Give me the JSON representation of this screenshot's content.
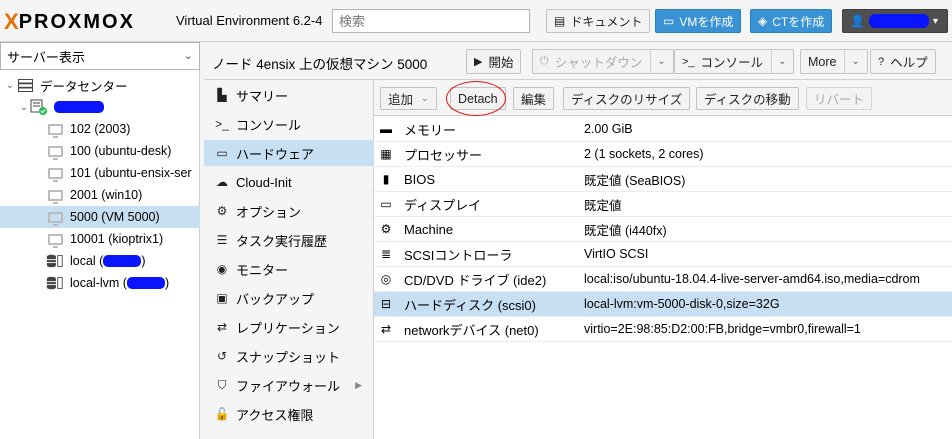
{
  "topbar": {
    "logo_mark": "X",
    "logo_word": "PROXMOX",
    "product": "Virtual Environment 6.2-4",
    "search_placeholder": "検索",
    "docs_label": "ドキュメント",
    "create_vm_label": "VMを作成",
    "create_ct_label": "CTを作成"
  },
  "tree": {
    "view_selector": "サーバー表示",
    "nodes": [
      {
        "label": "データセンター",
        "icon": "datacenter-icon"
      },
      {
        "label": "",
        "icon": "node-server-icon"
      },
      {
        "label": "102 (2003)",
        "icon": "vm-icon"
      },
      {
        "label": "100 (ubuntu-desk)",
        "icon": "vm-icon"
      },
      {
        "label": "101 (ubuntu-ensix-ser",
        "icon": "vm-icon"
      },
      {
        "label": "2001 (win10)",
        "icon": "vm-icon"
      },
      {
        "label": "5000 (VM 5000)",
        "icon": "vm-icon",
        "selected": true
      },
      {
        "label": "10001 (kioptrix1)",
        "icon": "vm-icon"
      },
      {
        "label": "local (",
        "suffix": ")",
        "icon": "storage-icon"
      },
      {
        "label": "local-lvm (",
        "suffix": ")",
        "icon": "storage-icon"
      }
    ]
  },
  "header": {
    "title": "ノード 4ensix 上の仮想マシン 5000",
    "start": "開始",
    "shutdown": "シャットダウン",
    "console": "コンソール",
    "more": "More",
    "help": "ヘルプ"
  },
  "subnav": {
    "items": [
      {
        "label": "サマリー",
        "icon": "summary-icon"
      },
      {
        "label": "コンソール",
        "icon": "terminal-icon"
      },
      {
        "label": "ハードウェア",
        "icon": "hardware-icon",
        "selected": true
      },
      {
        "label": "Cloud-Init",
        "icon": "cloud-icon"
      },
      {
        "label": "オプション",
        "icon": "gear-icon"
      },
      {
        "label": "タスク実行履歴",
        "icon": "list-icon"
      },
      {
        "label": "モニター",
        "icon": "eye-icon"
      },
      {
        "label": "バックアップ",
        "icon": "floppy-icon"
      },
      {
        "label": "レプリケーション",
        "icon": "retweet-icon"
      },
      {
        "label": "スナップショット",
        "icon": "history-icon"
      },
      {
        "label": "ファイアウォール",
        "icon": "shield-icon"
      },
      {
        "label": "アクセス権限",
        "icon": "unlock-icon"
      }
    ]
  },
  "toolbar": {
    "add": "追加",
    "detach": "Detach",
    "edit": "編集",
    "resize": "ディスクのリサイズ",
    "move": "ディスクの移動",
    "revert": "リバート"
  },
  "hardware": [
    {
      "key": "メモリー",
      "value": "2.00 GiB",
      "icon": "memory-icon"
    },
    {
      "key": "プロセッサー",
      "value": "2 (1 sockets, 2 cores)",
      "icon": "cpu-icon"
    },
    {
      "key": "BIOS",
      "value": "既定値 (SeaBIOS)",
      "icon": "microchip-icon"
    },
    {
      "key": "ディスプレイ",
      "value": "既定値",
      "icon": "desktop-icon"
    },
    {
      "key": "Machine",
      "value": "既定値 (i440fx)",
      "icon": "cogs-icon"
    },
    {
      "key": "SCSIコントローラ",
      "value": "VirtIO SCSI",
      "icon": "database-icon"
    },
    {
      "key": "CD/DVD ドライブ (ide2)",
      "value": "local:iso/ubuntu-18.04.4-live-server-amd64.iso,media=cdrom",
      "icon": "cdrom-icon"
    },
    {
      "key": "ハードディスク (scsi0)",
      "value": "local-lvm:vm-5000-disk-0,size=32G",
      "icon": "hdd-icon",
      "selected": true
    },
    {
      "key": "networkデバイス (net0)",
      "value": "virtio=2E:98:85:D2:00:FB,bridge=vmbr0,firewall=1",
      "icon": "exchange-icon"
    }
  ]
}
